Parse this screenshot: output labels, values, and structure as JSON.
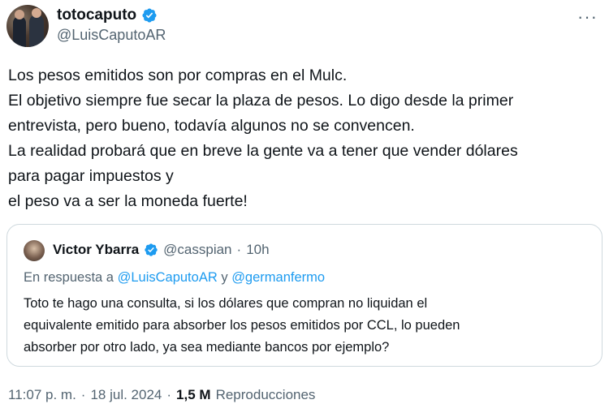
{
  "author": {
    "display_name": "totocaputo",
    "handle": "@LuisCaputoAR",
    "verified": true
  },
  "more_icon": "more-horizontal-icon",
  "tweet": {
    "lines": [
      "Los pesos emitidos son por compras en el Mulc.",
      "El objetivo siempre fue secar la plaza de pesos. Lo digo desde la primer",
      "entrevista, pero bueno, todavía algunos no se convencen.",
      "La realidad probará que en breve la gente va a tener que vender dólares",
      "para pagar impuestos y",
      "el peso va a ser la moneda fuerte!"
    ]
  },
  "quote": {
    "display_name": "Victor Ybarra",
    "handle": "@casspian",
    "separator": "·",
    "time": "10h",
    "reply_prefix": "En respuesta a",
    "reply_mention_1": "@LuisCaputoAR",
    "reply_conj": "y",
    "reply_mention_2": "@germanfermo",
    "lines": [
      "Toto te hago una consulta, si los dólares que compran no liquidan el",
      "equivalente emitido para absorber los pesos emitidos por CCL, lo pueden",
      "absorber por otro lado, ya sea mediante bancos por ejemplo?"
    ]
  },
  "meta": {
    "time": "11:07 p. m.",
    "sep1": "·",
    "date": "18 jul. 2024",
    "sep2": "·",
    "views_count": "1,5 M",
    "views_label": "Reproducciones"
  },
  "colors": {
    "verified": "#1d9bf0",
    "secondary_text": "#536471",
    "border": "#cfd9de"
  }
}
